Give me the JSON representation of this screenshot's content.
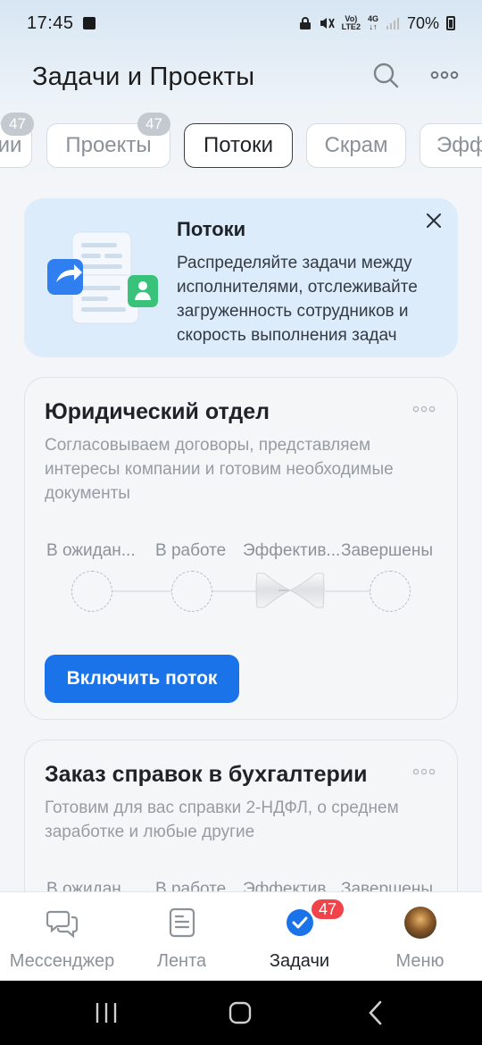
{
  "status_bar": {
    "time": "17:45",
    "network_top": "Vo)",
    "network_bottom": "LTE2",
    "network_gen": "4G",
    "battery": "70%"
  },
  "header": {
    "title": "Задачи и Проекты",
    "search_icon": "search-icon",
    "more_icon": "more-horizontal-icon"
  },
  "tabs": [
    {
      "label": "ии",
      "badge": "47"
    },
    {
      "label": "Проекты",
      "badge": "47"
    },
    {
      "label": "Потоки",
      "active": true
    },
    {
      "label": "Скрам"
    },
    {
      "label": "Эфф"
    }
  ],
  "info_card": {
    "title": "Потоки",
    "text": "Распределяйте задачи между исполнителями, отслеживайте загруженность сотрудников и скорость выполнения задач",
    "close_icon": "close-icon"
  },
  "flows": [
    {
      "title": "Юридический отдел",
      "description": "Согласовываем договоры, представляем интересы компании и готовим необходимые документы",
      "stages": [
        "В ожидан...",
        "В работе",
        "Эффектив...",
        "Завершены"
      ],
      "button": "Включить поток"
    },
    {
      "title": "Заказ справок в бухгалтерии",
      "description": "Готовим для вас справки 2-НДФЛ, о среднем заработке и любые другие",
      "stages": [
        "В ожидан...",
        "В работе",
        "Эффектив...",
        "Завершены"
      ]
    }
  ],
  "bottom_nav": {
    "items": [
      {
        "label": "Мессенджер",
        "icon": "chat-icon"
      },
      {
        "label": "Лента",
        "icon": "feed-icon"
      },
      {
        "label": "Задачи",
        "icon": "tasks-check-icon",
        "badge": "47",
        "active": true
      },
      {
        "label": "Меню",
        "icon": "avatar"
      }
    ]
  },
  "colors": {
    "accent": "#1a73e8",
    "badge_red": "#f0434a",
    "info_bg": "#dcecfb"
  }
}
